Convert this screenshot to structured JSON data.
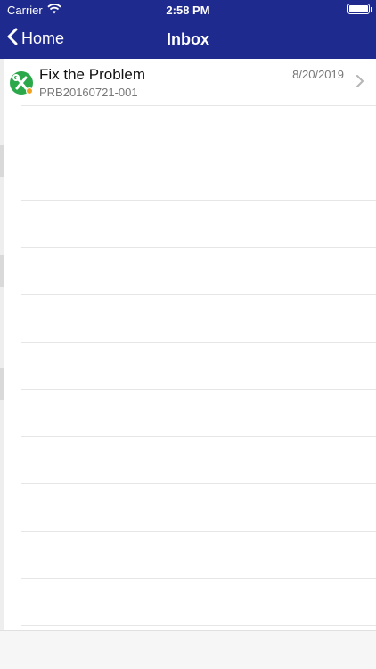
{
  "status_bar": {
    "carrier": "Carrier",
    "time": "2:58 PM",
    "wifi_icon": "wifi-icon",
    "battery_icon": "battery-icon"
  },
  "nav": {
    "back_label": "Home",
    "title": "Inbox",
    "color": "#1f2a8f"
  },
  "inbox": {
    "items": [
      {
        "title": "Fix the Problem",
        "subtitle": "PRB20160721-001",
        "date": "8/20/2019",
        "icon": "wrench-icon",
        "status_color": "#f2a11f"
      }
    ]
  }
}
